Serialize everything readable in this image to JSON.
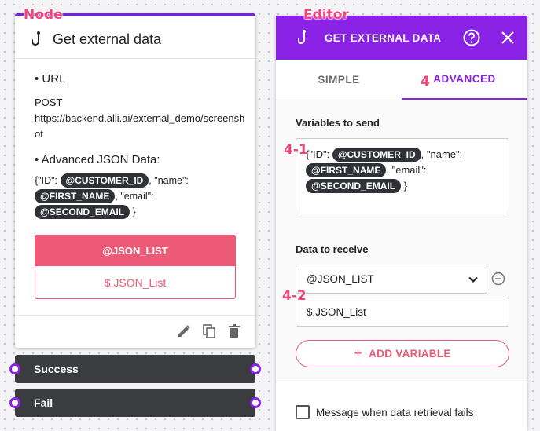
{
  "annotations": {
    "node": "Node",
    "editor": "Editor",
    "tab_marker": "4",
    "variables_marker": "4-1",
    "receive_marker": "4-2"
  },
  "node": {
    "title": "Get external data",
    "url_heading": "• URL",
    "method": "POST",
    "url": "https://backend.alli.ai/external_demo/screenshot",
    "json_heading": "• Advanced JSON Data:",
    "json": {
      "open": "{\"ID\":",
      "customer_id": "@CUSTOMER_ID",
      "name_key": ", \"name\":",
      "first_name": "@FIRST_NAME",
      "email_key": ", \"email\":",
      "second_email": "@SECOND_EMAIL",
      "close": "}"
    },
    "receive": {
      "variable": "@JSON_LIST",
      "path": "$.JSON_List"
    },
    "outlets": {
      "success": "Success",
      "fail": "Fail"
    }
  },
  "editor": {
    "title": "GET EXTERNAL DATA",
    "tabs": {
      "simple": "SIMPLE",
      "advanced": "ADVANCED"
    },
    "variables_label": "Variables to send",
    "variables": {
      "open": "{\"ID\":",
      "customer_id": "@CUSTOMER_ID",
      "name_key": ", \"name\":",
      "first_name": "@FIRST_NAME",
      "email_key": ", \"email\":",
      "second_email": "@SECOND_EMAIL",
      "close": "}"
    },
    "receive_label": "Data to receive",
    "select_value": "@JSON_LIST",
    "path_value": "$.JSON_List",
    "add_variable": "ADD VARIABLE",
    "fail_checkbox_label": "Message when data retrieval fails"
  },
  "colors": {
    "accent": "#8a22e6",
    "pink": "#ec5a77",
    "chip": "#2f3136",
    "outlet": "#3a3c40",
    "annotation": "#f0457a"
  },
  "icons": [
    "hook-icon",
    "help-icon",
    "close-icon",
    "edit-icon",
    "copy-icon",
    "delete-icon",
    "chevron-down-icon",
    "remove-circle-icon",
    "plus-icon"
  ]
}
